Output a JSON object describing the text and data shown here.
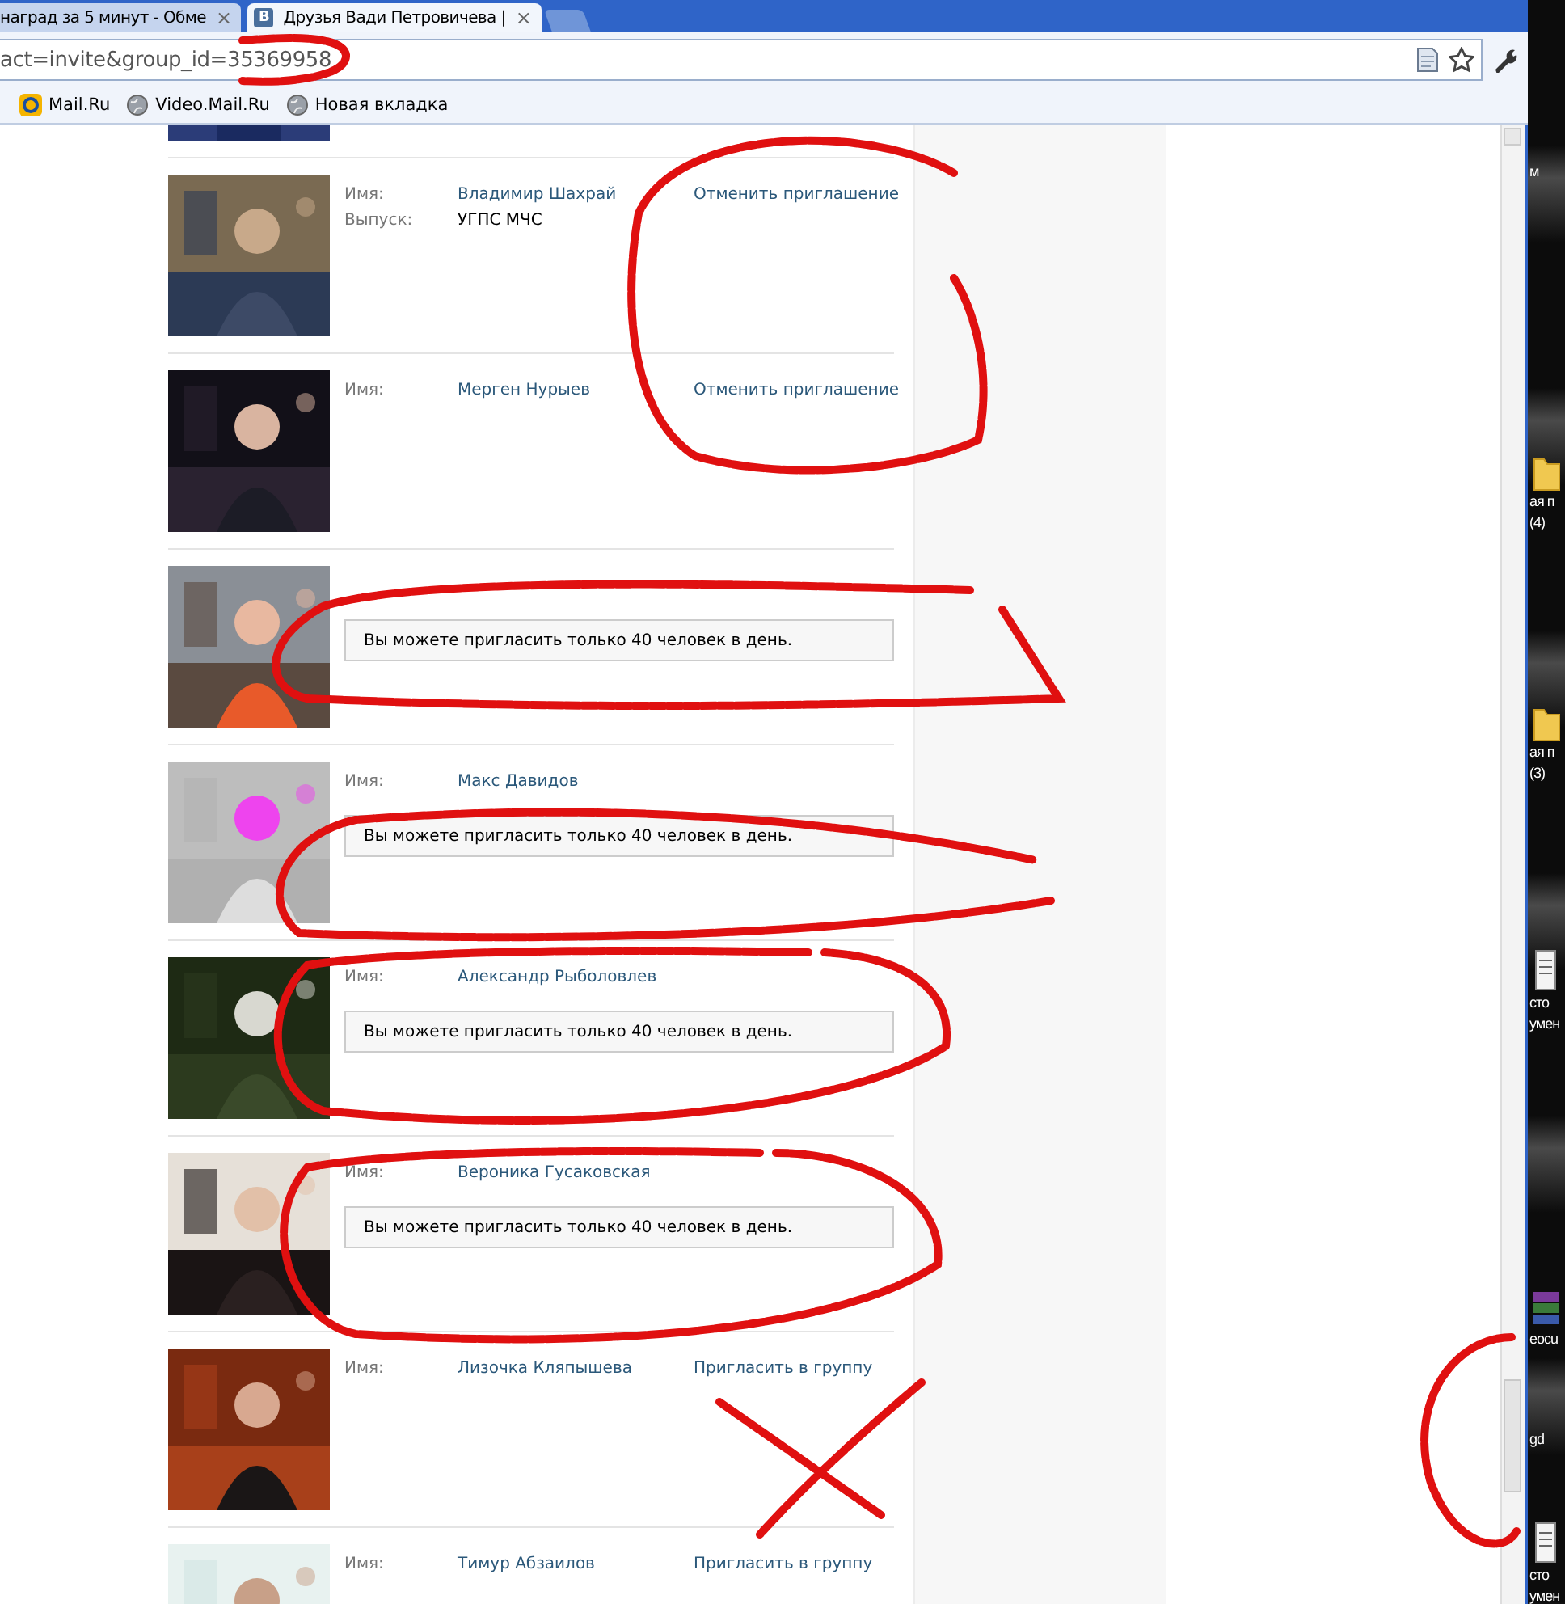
{
  "browser": {
    "tabs": [
      {
        "title": "наград за 5 минут - Обме",
        "close": "×",
        "selected": false,
        "kind": "page"
      },
      {
        "title": "Друзья Вади Петровичева |",
        "close": "×",
        "selected": true,
        "kind": "vk",
        "badge": "В"
      }
    ],
    "address": "act=invite&group_id=35369958",
    "bookmarks": [
      {
        "kind": "mail",
        "label": "Mail.Ru"
      },
      {
        "kind": "globe",
        "label": "Video.Mail.Ru"
      },
      {
        "kind": "globe",
        "label": "Новая вкладка"
      }
    ]
  },
  "members": [
    {
      "name_label": "Имя:",
      "name": "Владимир Шахрай",
      "grad_label": "Выпуск:",
      "grad": "УГПС МЧС",
      "action": "Отменить приглашение"
    },
    {
      "name_label": "Имя:",
      "name": "Мерген Нурыев",
      "action": "Отменить приглашение"
    },
    {
      "notice": "Вы можете пригласить только 40 человек в день."
    },
    {
      "name_label": "Имя:",
      "name": "Макс Давидов",
      "notice": "Вы можете пригласить только 40 человек в день."
    },
    {
      "name_label": "Имя:",
      "name": "Александр Рыболовлев",
      "notice": "Вы можете пригласить только 40 человек в день."
    },
    {
      "name_label": "Имя:",
      "name": "Вероника Гусаковская",
      "notice": "Вы можете пригласить только 40 человек в день."
    },
    {
      "name_label": "Имя:",
      "name": "Лизочка Кляпышева",
      "action": "Пригласить в группу"
    },
    {
      "name_label": "Имя:",
      "name": "Тимур Абзаилов",
      "action": "Пригласить в группу"
    }
  ],
  "desktop_icons": [
    {
      "kind": "none",
      "labels": [
        "м"
      ]
    },
    {
      "kind": "folder",
      "labels": [
        "ая п",
        "(4)"
      ]
    },
    {
      "kind": "folder",
      "labels": [
        "ая п",
        "(3)"
      ]
    },
    {
      "kind": "document",
      "labels": [
        "сто",
        "умен"
      ]
    },
    {
      "kind": "archive",
      "labels": [
        "eocu"
      ]
    },
    {
      "kind": "none",
      "labels": [
        "gd"
      ]
    },
    {
      "kind": "document",
      "labels": [
        "сто",
        "умен"
      ]
    }
  ]
}
